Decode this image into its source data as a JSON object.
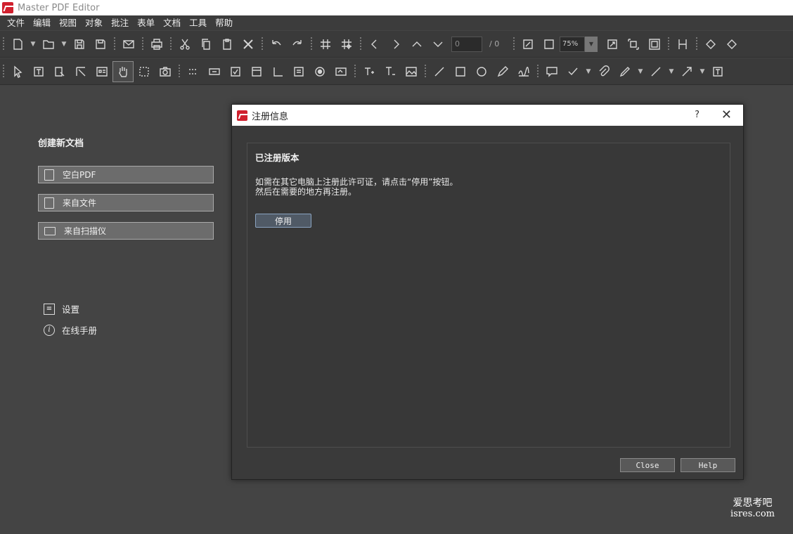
{
  "app": {
    "title": "Master PDF Editor"
  },
  "menu": [
    "文件",
    "编辑",
    "视图",
    "对象",
    "批注",
    "表单",
    "文档",
    "工具",
    "帮助"
  ],
  "toolbar": {
    "page_input": "0",
    "page_total": "/ 0",
    "zoom": "75%"
  },
  "start": {
    "create_title": "创建新文档",
    "blank_pdf": "空白PDF",
    "from_file": "来自文件",
    "from_scanner": "来自扫描仪",
    "settings": "设置",
    "online_manual": "在线手册"
  },
  "dialog": {
    "title": "注册信息",
    "help_glyph": "?",
    "close_glyph": "✕",
    "heading": "已注册版本",
    "line1": "如需在其它电脑上注册此许可证，请点击“停用”按钮。",
    "line2": "然后在需要的地方再注册。",
    "deactivate_label": "停用",
    "close_label": "Close",
    "help_label": "Help"
  },
  "watermark": {
    "line1": "爱思考吧",
    "line2": "isres.com"
  }
}
